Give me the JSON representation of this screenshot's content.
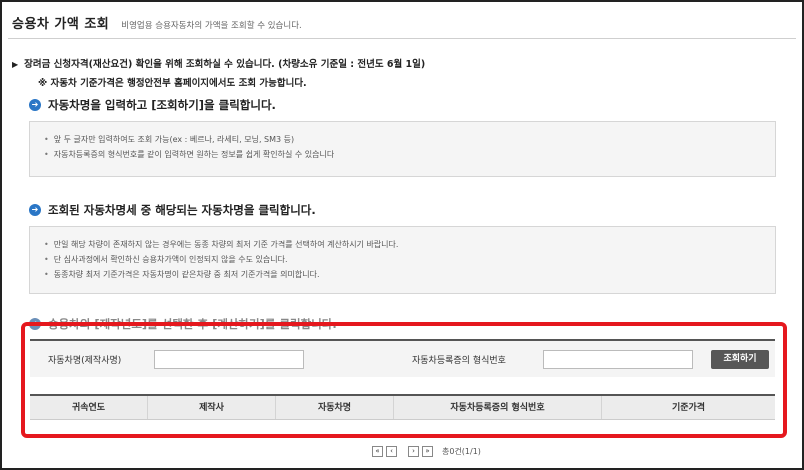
{
  "header": {
    "title": "승용차 가액 조회",
    "subtitle": "비영업용 승용자동차의 가액을 조회할 수 있습니다."
  },
  "notices": {
    "line1": "장려금 신청자격(재산요건) 확인을 위해 조회하실 수 있습니다. (차량소유 기준일 : 전년도 6월 1일)",
    "line2": "※ 자동차 기준가격은 행정안전부 홈페이지에서도 조회 가능합니다."
  },
  "steps": {
    "step1": "자동차명을 입력하고 [조회하기]을 클릭합니다.",
    "step2": "조회된 자동차명세 중 해당되는 자동차명을 클릭합니다.",
    "step3": "승용차의 [제작년도]를 선택한 후 [계산하기]를 클릭합니다."
  },
  "tips1": [
    "앞 두 글자만 입력하여도 조회 가능(ex : 베르나, 라세티, 모닝, SM3 등)",
    "자동차등록증의 형식번호를 같이 입력하면 원하는 정보를 쉽게 확인하실 수 있습니다"
  ],
  "tips2": [
    "만일 해당 차량이 존재하지 않는 경우에는 동종 차량의 최저 기준 가격를 선택하여 계산하시기 바랍니다.",
    "단 심사과정에서 확인하신 승용차가액이 인정되지 않을 수도 있습니다.",
    "동종차량 최저 기준가격은 자동차명이 같은차량 중  최저 기준가격을 의미합니다."
  ],
  "search": {
    "name_label": "자동차명(제작사명)",
    "name_value": "",
    "reg_label": "자동차등록증의 형식번호",
    "reg_value": "",
    "button": "조회하기"
  },
  "table": {
    "columns": [
      "귀속연도",
      "제작사",
      "자동차명",
      "자동차등록증의 형식번호",
      "기준가격"
    ]
  },
  "pager": {
    "first": "«",
    "prev": "‹",
    "next": "›",
    "last": "»",
    "info": "총0건(1/1)"
  },
  "colors": {
    "highlight_border": "#e5181e",
    "step_icon": "#2a76c6",
    "button_bg": "#575757"
  }
}
